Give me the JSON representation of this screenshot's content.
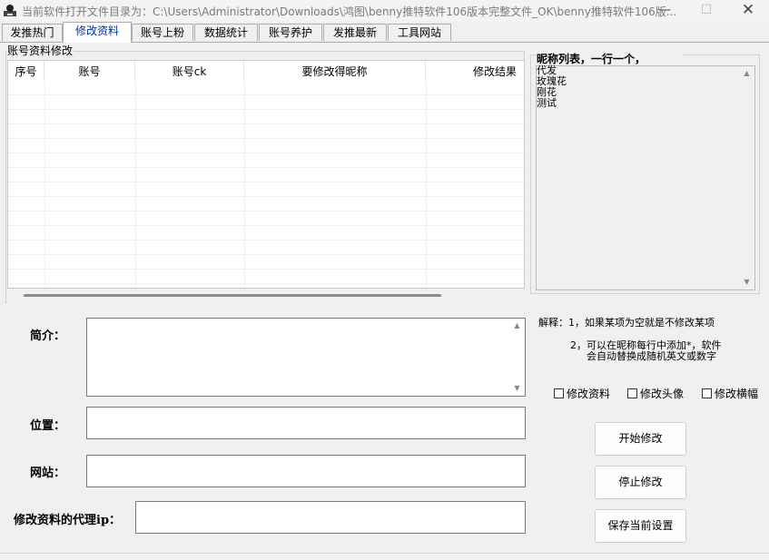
{
  "window": {
    "title": "当前软件打开文件目录为：C:\\Users\\Administrator\\Downloads\\鸿图\\benny推特软件106版本完整文件_OK\\benny推特软件106版...",
    "minimize_icon": "minimize-icon",
    "maximize_icon": "maximize-icon",
    "close_icon": "close-icon"
  },
  "tabs": [
    {
      "label": "发推热门"
    },
    {
      "label": "修改资料",
      "active": true
    },
    {
      "label": "账号上粉"
    },
    {
      "label": "数据统计"
    },
    {
      "label": "账号养护"
    },
    {
      "label": "发推最新"
    },
    {
      "label": "工具网站"
    }
  ],
  "account_group": {
    "label": "账号资料修改",
    "columns": [
      "序号",
      "账号",
      "账号ck",
      "要修改得昵称",
      "修改结果"
    ]
  },
  "nickname": {
    "label": "昵称列表，一行一个，",
    "lines": "代发\n玫瑰花\n刚花\n测试"
  },
  "form": {
    "bio_label": "简介：",
    "bio_value": "",
    "location_label": "位置：",
    "location_value": "",
    "website_label": "网站：",
    "website_value": "",
    "proxy_label": "修改资料的代理ip：",
    "proxy_value": ""
  },
  "notes": {
    "line1": "解释：1，如果某项为空就是不修改某项",
    "line2": "2，可以在昵称每行中添加*，软件",
    "line3": "会自动替换成随机英文或数字"
  },
  "checkboxes": [
    {
      "label": "修改资料",
      "checked": false
    },
    {
      "label": "修改头像",
      "checked": false
    },
    {
      "label": "修改横幅",
      "checked": false
    }
  ],
  "buttons": {
    "start": "开始修改",
    "stop": "停止修改",
    "save": "保存当前设置"
  }
}
